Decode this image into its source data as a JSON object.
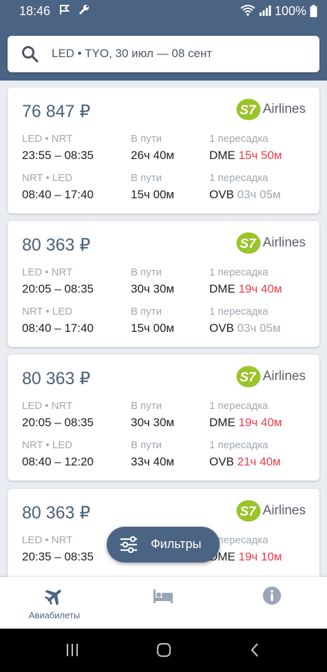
{
  "status": {
    "time": "18:46",
    "battery": "100%",
    "icons": [
      "flag-icon",
      "wrench-icon",
      "wifi-icon",
      "signal-icon",
      "battery-icon"
    ]
  },
  "search": {
    "query": "LED • TYO, 30 июл — 08 сент"
  },
  "colors": {
    "primary": "#4c6483",
    "price": "#4b6079",
    "alert": "#ec3b48",
    "muted": "#a1a7ad",
    "logo_green": "#9bc32a"
  },
  "common": {
    "in_transit": "В пути",
    "one_stop": "1 пересадка",
    "airline": "Airlines"
  },
  "cards": [
    {
      "price": "76 847 ₽",
      "legs": [
        {
          "route": "LED • NRT",
          "times": "23:55 – 08:35",
          "duration": "26ч 40м",
          "stop_code": "DME",
          "layover": "15ч 50м",
          "layover_long": true
        },
        {
          "route": "NRT • LED",
          "times": "08:40 – 17:40",
          "duration": "15ч 00м",
          "stop_code": "OVB",
          "layover": "03ч 05м",
          "layover_long": false
        }
      ]
    },
    {
      "price": "80 363 ₽",
      "legs": [
        {
          "route": "LED • NRT",
          "times": "20:05 – 08:35",
          "duration": "30ч 30м",
          "stop_code": "DME",
          "layover": "19ч 40м",
          "layover_long": true
        },
        {
          "route": "NRT • LED",
          "times": "08:40 – 17:40",
          "duration": "15ч 00м",
          "stop_code": "OVB",
          "layover": "03ч 05м",
          "layover_long": false
        }
      ]
    },
    {
      "price": "80 363 ₽",
      "legs": [
        {
          "route": "LED • NRT",
          "times": "20:05 – 08:35",
          "duration": "30ч 30м",
          "stop_code": "DME",
          "layover": "19ч 40м",
          "layover_long": true
        },
        {
          "route": "NRT • LED",
          "times": "08:40 – 12:20",
          "duration": "33ч 40м",
          "stop_code": "OVB",
          "layover": "21ч 40м",
          "layover_long": true
        }
      ]
    },
    {
      "price": "80 363 ₽",
      "legs": [
        {
          "route": "LED • NRT",
          "times": "20:35 – 08:35",
          "duration": "",
          "stop_code": "DME",
          "layover": "19ч 10м",
          "layover_long": true
        },
        {
          "route": "",
          "times": "",
          "duration": "",
          "stop_code": "",
          "layover": "",
          "layover_long": false
        }
      ]
    }
  ],
  "fab": {
    "label": "Фильтры"
  },
  "bottom_nav": [
    {
      "label": "Авиабилеты",
      "icon": "airplane-icon",
      "active": true
    },
    {
      "label": "",
      "icon": "bed-icon",
      "active": false
    },
    {
      "label": "",
      "icon": "info-icon",
      "active": false
    }
  ],
  "system_nav": [
    "recents-icon",
    "home-icon",
    "back-icon"
  ]
}
